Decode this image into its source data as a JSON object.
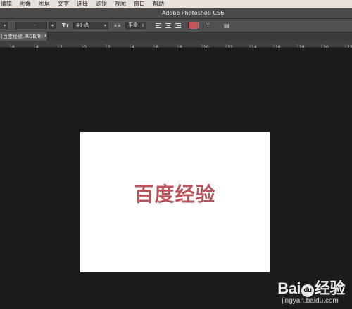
{
  "menubar": {
    "items": [
      "编辑",
      "图像",
      "图层",
      "文字",
      "选择",
      "滤镜",
      "视图",
      "窗口",
      "帮助"
    ]
  },
  "app": {
    "title": "Adobe Photoshop CS6"
  },
  "options_bar": {
    "font_family": "",
    "font_style": "-",
    "font_size": "48 点",
    "antialias_label": "a a",
    "antialias": "平滑",
    "text_color": "#c0565c",
    "icons": [
      "font-size-icon",
      "antialias-icon",
      "align-left-icon",
      "align-center-icon",
      "align-right-icon",
      "warp-text-icon",
      "panels-icon"
    ]
  },
  "document": {
    "tab_label": "(百度经验, RGB/8) *"
  },
  "ruler": {
    "ticks": [
      "6",
      "4",
      "2",
      "0",
      "2",
      "4",
      "6",
      "8",
      "10",
      "12",
      "14",
      "16",
      "18",
      "20",
      "22",
      "2"
    ]
  },
  "canvas": {
    "text": "百度经验",
    "text_color": "#b9535b",
    "background": "#ffffff"
  },
  "watermark": {
    "logo_left": "Bai",
    "logo_paw": "du",
    "logo_right": "经验",
    "site": "jingyan.baidu.com"
  }
}
